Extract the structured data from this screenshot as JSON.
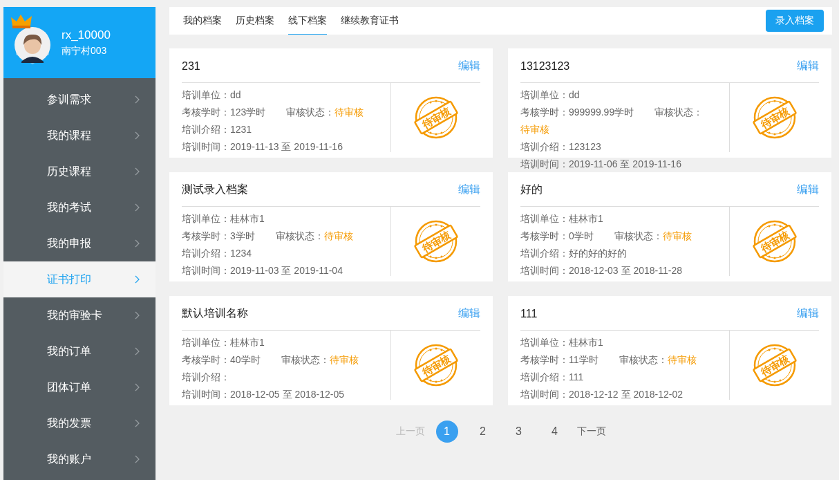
{
  "user": {
    "name": "rx_10000",
    "org": "南宁村003"
  },
  "sidebar": {
    "items": [
      {
        "label": "参训需求",
        "selected": false
      },
      {
        "label": "我的课程",
        "selected": false
      },
      {
        "label": "历史课程",
        "selected": false
      },
      {
        "label": "我的考试",
        "selected": false
      },
      {
        "label": "我的申报",
        "selected": false
      },
      {
        "label": "证书打印",
        "selected": true
      },
      {
        "label": "我的审验卡",
        "selected": false
      },
      {
        "label": "我的订单",
        "selected": false
      },
      {
        "label": "团体订单",
        "selected": false
      },
      {
        "label": "我的发票",
        "selected": false
      },
      {
        "label": "我的账户",
        "selected": false
      }
    ]
  },
  "tabs": [
    {
      "label": "我的档案",
      "selected": false
    },
    {
      "label": "历史档案",
      "selected": false
    },
    {
      "label": "线下档案",
      "selected": true
    },
    {
      "label": "继续教育证书",
      "selected": false
    }
  ],
  "add_button": "录入档案",
  "records": [
    {
      "title": "231",
      "edit": "编辑",
      "unit": "培训单位：dd",
      "hours": "考核学时：123学时",
      "status_label": "审核状态：",
      "status": "待审核",
      "intro": "培训介绍：1231",
      "time": "培训时间：2019-11-13 至 2019-11-16",
      "stamp": "待审核"
    },
    {
      "title": "13123123",
      "edit": "编辑",
      "unit": "培训单位：dd",
      "hours": "考核学时：999999.99学时",
      "status_label": "审核状态：",
      "status": "待审核",
      "intro": "培训介绍：123123",
      "time": "培训时间：2019-11-06 至 2019-11-16",
      "stamp": "待审核"
    },
    {
      "title": "测试录入档案",
      "edit": "编辑",
      "unit": "培训单位：桂林市1",
      "hours": "考核学时：3学时",
      "status_label": "审核状态：",
      "status": "待审核",
      "intro": "培训介绍：1234",
      "time": "培训时间：2019-11-03 至 2019-11-04",
      "stamp": "待审核"
    },
    {
      "title": "好的",
      "edit": "编辑",
      "unit": "培训单位：桂林市1",
      "hours": "考核学时：0学时",
      "status_label": "审核状态：",
      "status": "待审核",
      "intro": "培训介绍：好的好的好的",
      "time": "培训时间：2018-12-03 至 2018-11-28",
      "stamp": "待审核"
    },
    {
      "title": "默认培训名称",
      "edit": "编辑",
      "unit": "培训单位：桂林市1",
      "hours": "考核学时：40学时",
      "status_label": "审核状态：",
      "status": "待审核",
      "intro": "培训介绍：",
      "time": "培训时间：2018-12-05 至 2018-12-05",
      "stamp": "待审核"
    },
    {
      "title": "111",
      "edit": "编辑",
      "unit": "培训单位：桂林市1",
      "hours": "考核学时：11学时",
      "status_label": "审核状态：",
      "status": "待审核",
      "intro": "培训介绍：111",
      "time": "培训时间：2018-12-12 至 2018-12-02",
      "stamp": "待审核"
    }
  ],
  "pagination": {
    "prev": {
      "label": "上一页",
      "disabled": true
    },
    "pages": [
      {
        "label": "1",
        "selected": true
      },
      {
        "label": "2",
        "selected": false
      },
      {
        "label": "3",
        "selected": false
      },
      {
        "label": "4",
        "selected": false
      }
    ],
    "next": {
      "label": "下一页",
      "disabled": false
    }
  }
}
